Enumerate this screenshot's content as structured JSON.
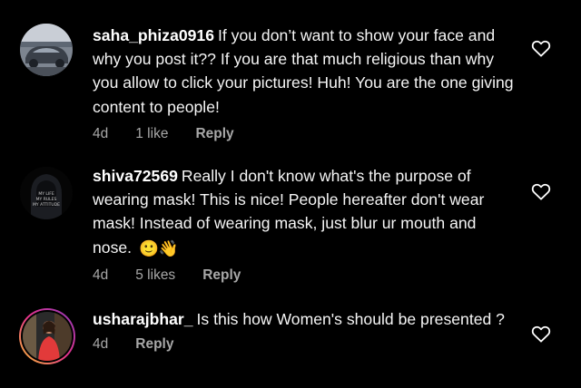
{
  "comments": [
    {
      "username": "saha_phiza0916",
      "text": "If you don’t want to show your face and why you post it?? If you are that much religious than why you allow to click your pictures! Huh! You are the one giving content to people!",
      "age": "4d",
      "likes": "1 like",
      "reply": "Reply",
      "avatar": "car-avatar"
    },
    {
      "username": "shiva72569",
      "text": "Really I don't know what's the purpose of wearing mask! This is nice! People hereafter don't wear mask! Instead of wearing mask, just blur ur mouth and nose.",
      "emoji": "🙂👋",
      "age": "4d",
      "likes": "5 likes",
      "reply": "Reply",
      "avatar_lines": [
        "MY LIFE",
        "MY RULES",
        "MY ATTITUDE"
      ]
    },
    {
      "username": "usharajbhar_",
      "text": "Is this how Women's should be presented ?",
      "age": "4d",
      "reply": "Reply",
      "avatar": "story-ring-avatar"
    }
  ],
  "colors": {
    "background": "#000000",
    "meta_text": "#a8a8a8",
    "story_ring": [
      "#f9c433",
      "#e6338a",
      "#8a3ab9"
    ]
  },
  "icons": [
    "heart-outline-icon"
  ]
}
